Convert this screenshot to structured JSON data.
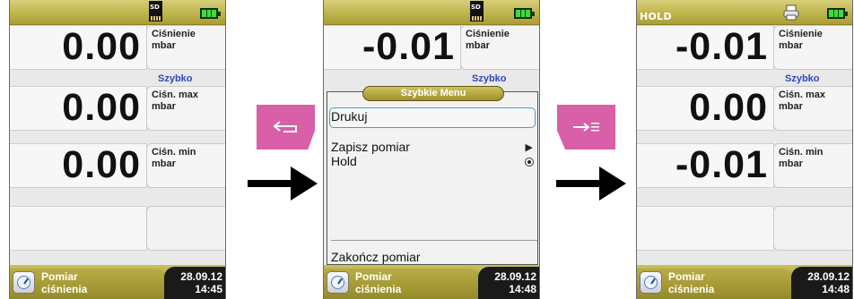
{
  "screens": [
    {
      "status": {
        "hold": "",
        "sd": "SD"
      },
      "readings": [
        {
          "value": "0.00",
          "label1": "Ciśnienie",
          "label2": "mbar",
          "mode": "Szybko"
        },
        {
          "value": "0.00",
          "label1": "Ciśn. max",
          "label2": "mbar"
        },
        {
          "value": "0.00",
          "label1": "Ciśn. min",
          "label2": "mbar"
        }
      ],
      "footer": {
        "title_line1": "Pomiar",
        "title_line2": "ciśnienia",
        "date": "28.09.12",
        "time": "14:45"
      }
    },
    {
      "status": {
        "hold": "",
        "sd": "SD"
      },
      "readings": [
        {
          "value": "-0.01",
          "label1": "Ciśnienie",
          "label2": "mbar",
          "mode": "Szybko"
        }
      ],
      "menu": {
        "title": "Szybkie Menu",
        "items": [
          "Drukuj",
          "Zapisz pomiar",
          "Hold"
        ],
        "exit": "Zakończ pomiar"
      },
      "footer": {
        "title_line1": "Pomiar",
        "title_line2": "ciśnienia",
        "date": "28.09.12",
        "time": "14:48"
      }
    },
    {
      "status": {
        "hold": "HOLD"
      },
      "readings": [
        {
          "value": "-0.01",
          "label1": "Ciśnienie",
          "label2": "mbar",
          "mode": "Szybko"
        },
        {
          "value": "0.00",
          "label1": "Ciśn. max",
          "label2": "mbar"
        },
        {
          "value": "-0.01",
          "label1": "Ciśn. min",
          "label2": "mbar"
        }
      ],
      "footer": {
        "title_line1": "Pomiar",
        "title_line2": "ciśnienia",
        "date": "28.09.12",
        "time": "14:48"
      }
    }
  ],
  "softkeys": {
    "back_icon": "return-arrow-icon",
    "print_icon": "arrow-to-list-icon"
  },
  "colors": {
    "header": "#bfb44d",
    "softkey": "#d85fa8",
    "mode_text": "#3347c2",
    "selection": "#3d9fd4"
  }
}
